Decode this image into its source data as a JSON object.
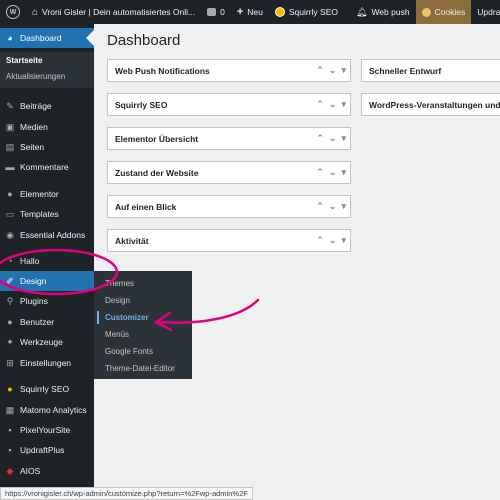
{
  "adminbar": {
    "site_title": "Vroni Gisler | Dein automatisiertes Onli...",
    "comments_count": "0",
    "new_label": "Neu",
    "squirrly_label": "Squirrly SEO",
    "webpush_label": "Web push",
    "cookies_label": "Cookies",
    "updraft_label": "UpdraftPlus"
  },
  "sidebar": {
    "dashboard": "Dashboard",
    "sub_startseite": "Startseite",
    "sub_aktualisierungen": "Aktualisierungen",
    "items": [
      "Beiträge",
      "Medien",
      "Seiten",
      "Kommentare",
      "Elementor",
      "Templates",
      "Essential Addons",
      "Hallo",
      "Design",
      "Plugins",
      "Benutzer",
      "Werkzeuge",
      "Einstellungen",
      "Squirrly SEO",
      "Matomo Analytics",
      "PixelYourSite",
      "UpdraftPlus",
      "AIOS"
    ]
  },
  "flyout": {
    "items": [
      "Themes",
      "Design",
      "Customizer",
      "Menüs",
      "Google Fonts",
      "Theme-Datei-Editor"
    ]
  },
  "main": {
    "title": "Dashboard",
    "left_widgets": [
      "Web Push Notifications",
      "Squirrly SEO",
      "Elementor Übersicht",
      "Zustand der Website",
      "Auf einen Blick",
      "Aktivität"
    ],
    "right_widgets": [
      "Schneller Entwurf",
      "WordPress-Veranstaltungen und Neuigkeiten"
    ]
  },
  "statusbar": {
    "url": "https://vronigisler.ch/wp-admin/customize.php?return=%2Fwp-admin%2F"
  },
  "colors": {
    "admin_bg": "#1d2327",
    "active_blue": "#2271b1",
    "annotation_pink": "#e4007c",
    "cookies_bg": "#8a6d3b"
  }
}
